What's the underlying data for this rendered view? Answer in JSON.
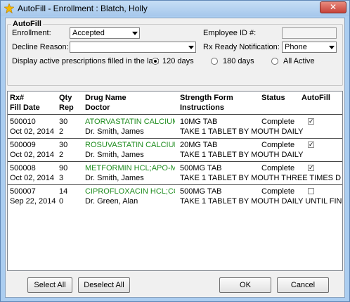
{
  "window": {
    "title": "AutoFill - Enrollment : Blatch, Holly",
    "close_label": "✕"
  },
  "autofill": {
    "legend": "AutoFill",
    "enrollment_label": "Enrollment:",
    "enrollment_value": "Accepted",
    "employee_id_label": "Employee ID #:",
    "employee_id_value": "",
    "decline_label": "Decline Reason:",
    "decline_value": "",
    "rx_ready_label": "Rx Ready Notification:",
    "rx_ready_value": "Phone",
    "display_label": "Display active prescriptions filled in the last",
    "radio_options": [
      "120 days",
      "180 days",
      "All Active"
    ],
    "radio_selected": "120 days"
  },
  "list": {
    "headers": {
      "rx": "Rx#",
      "fill_date": "Fill Date",
      "qty": "Qty",
      "rep": "Rep",
      "drug": "Drug Name",
      "doctor": "Doctor",
      "strength": "Strength Form",
      "instructions": "Instructions",
      "status": "Status",
      "autofill": "AutoFill"
    },
    "rows": [
      {
        "rx": "500010",
        "date": "Oct 02, 2014",
        "qty": "30",
        "rep": "2",
        "drug": "ATORVASTATIN CALCIUM;(",
        "doctor": "Dr. Smith, James",
        "strength": "10MG TAB",
        "instructions": "TAKE 1 TABLET BY MOUTH DAILY",
        "status": "Complete",
        "autofill": true
      },
      {
        "rx": "500009",
        "date": "Oct 02, 2014",
        "qty": "30",
        "rep": "2",
        "drug": "ROSUVASTATIN CALCIUM;C",
        "doctor": "Dr. Smith, James",
        "strength": "20MG TAB",
        "instructions": "TAKE 1 TABLET BY MOUTH DAILY",
        "status": "Complete",
        "autofill": true
      },
      {
        "rx": "500008",
        "date": "Oct 02, 2014",
        "qty": "90",
        "rep": "3",
        "drug": "METFORMIN HCL;APO-MET",
        "doctor": "Dr. Smith, James",
        "strength": "500MG TAB",
        "instructions": "TAKE 1 TABLET BY MOUTH THREE TIMES D",
        "status": "Complete",
        "autofill": true
      },
      {
        "rx": "500007",
        "date": "Sep 22, 2014",
        "qty": "14",
        "rep": "0",
        "drug": "CIPROFLOXACIN HCL;CO-(",
        "doctor": "Dr. Green, Alan",
        "strength": "500MG TAB",
        "instructions": "TAKE 1 TABLET BY MOUTH DAILY UNTIL FIN",
        "status": "Complete",
        "autofill": false
      }
    ]
  },
  "buttons": {
    "select_all": "Select All",
    "deselect_all": "Deselect All",
    "ok": "OK",
    "cancel": "Cancel"
  },
  "colors": {
    "drug_name": "#1e8c1e",
    "title_bar": "#abcdf0",
    "close_button": "#c7433a"
  },
  "icons": {
    "app": "autofill-star-icon",
    "close": "close-icon",
    "dropdown": "chevron-down-icon"
  }
}
